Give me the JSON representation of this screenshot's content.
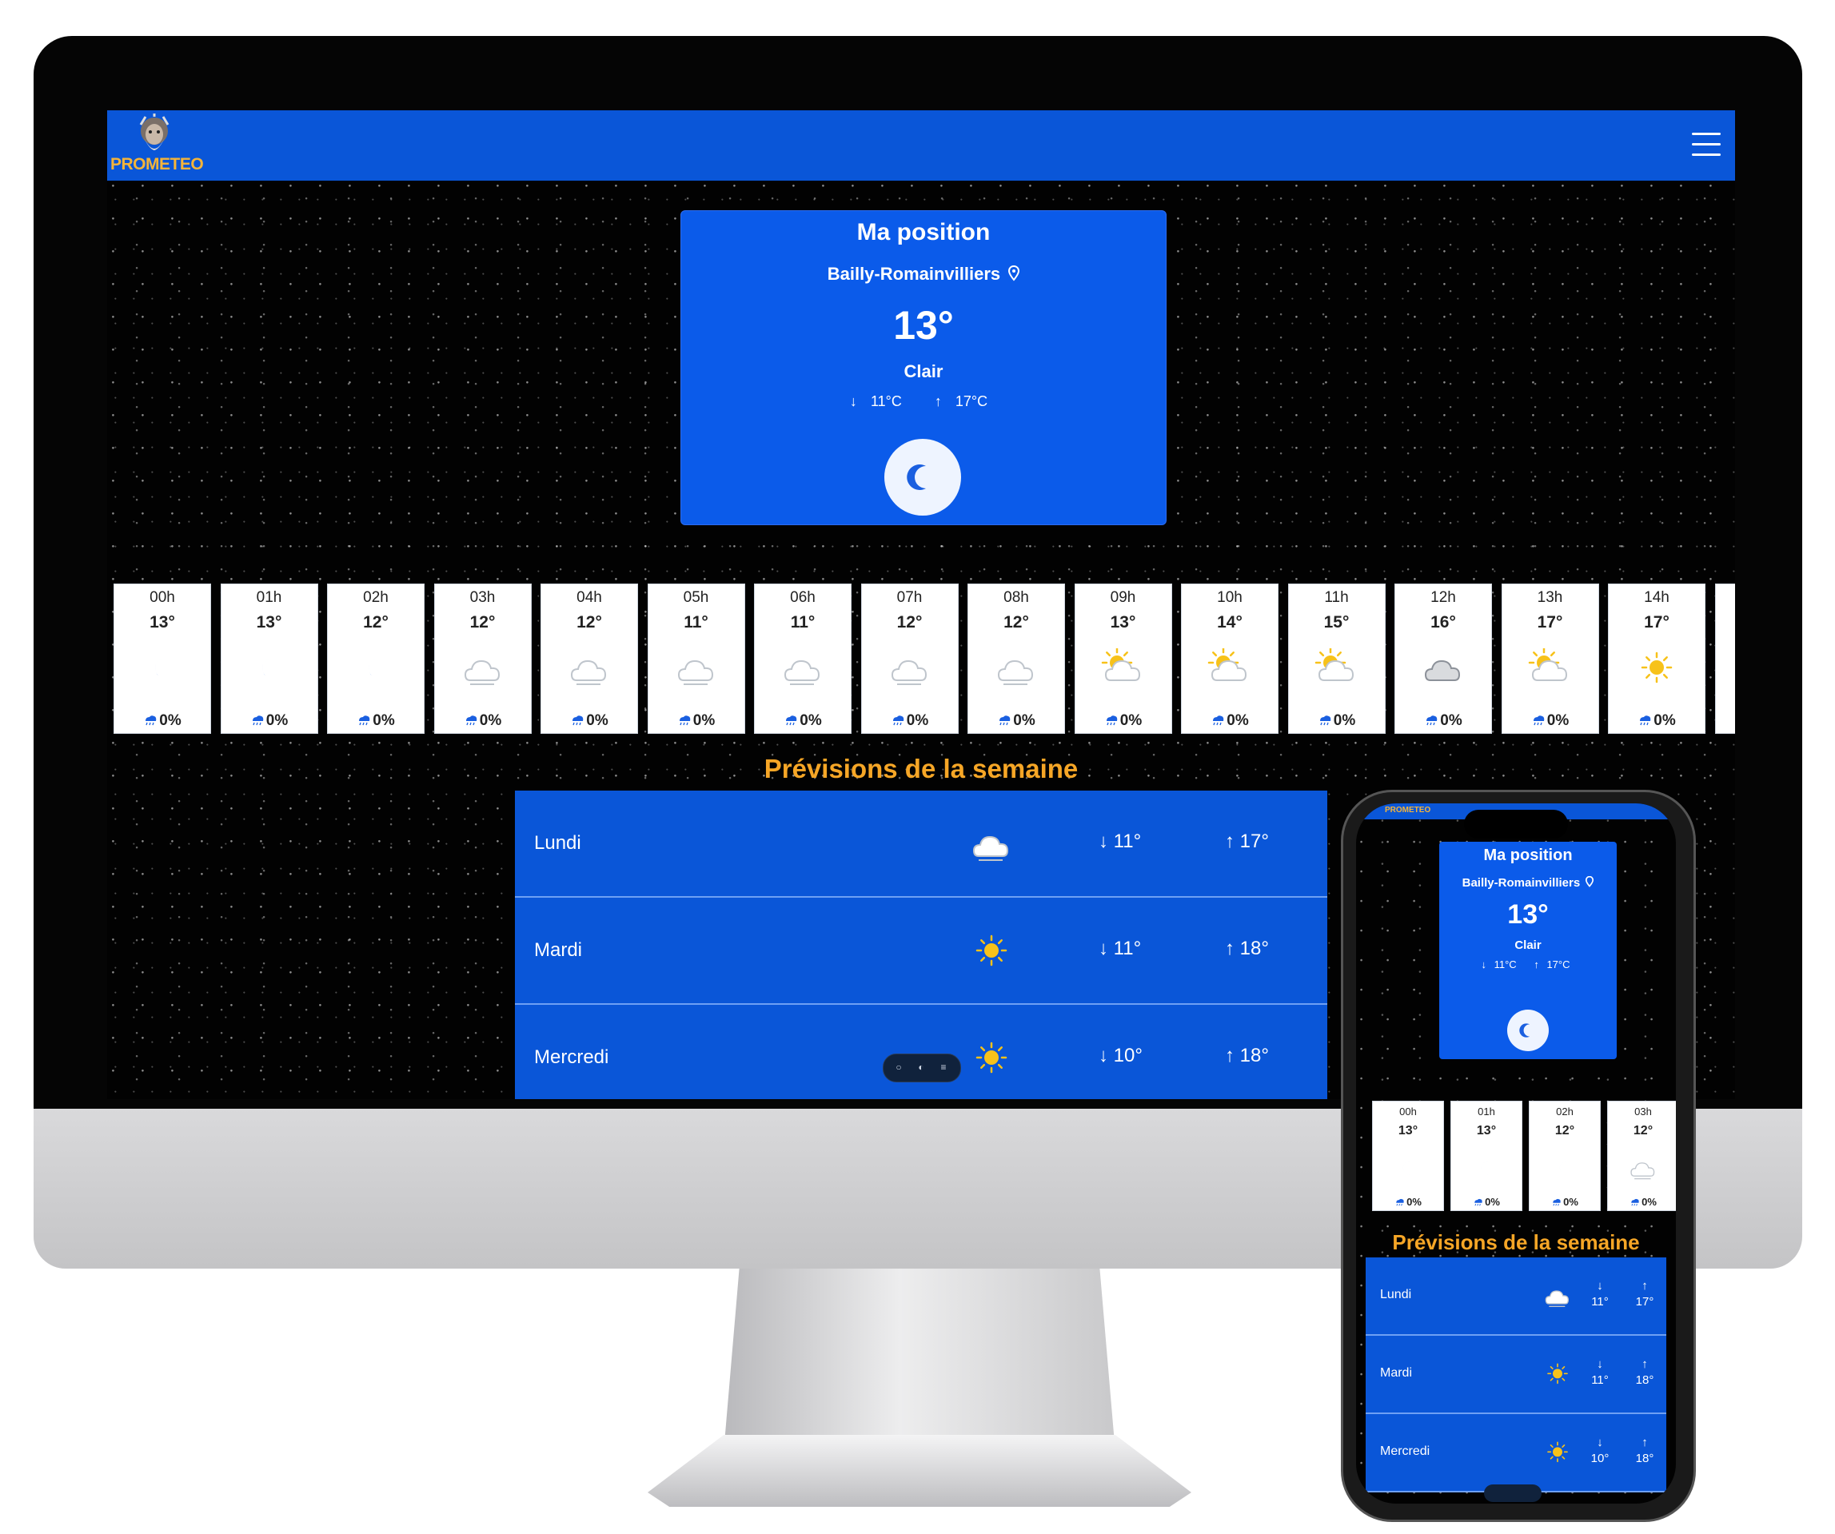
{
  "app": {
    "logo_text": "PROMETEO"
  },
  "current": {
    "title": "Ma position",
    "city": "Bailly-Romainvilliers",
    "temperature": "13°",
    "condition": "Clair",
    "min": "11°C",
    "max": "17°C",
    "icon": "moon-icon"
  },
  "hourly": [
    {
      "time": "00h",
      "temp": "13°",
      "icon": "moon",
      "rain": "0%"
    },
    {
      "time": "01h",
      "temp": "13°",
      "icon": "moon",
      "rain": "0%"
    },
    {
      "time": "02h",
      "temp": "12°",
      "icon": "moon",
      "rain": "0%"
    },
    {
      "time": "03h",
      "temp": "12°",
      "icon": "cloud",
      "rain": "0%"
    },
    {
      "time": "04h",
      "temp": "12°",
      "icon": "cloud",
      "rain": "0%"
    },
    {
      "time": "05h",
      "temp": "11°",
      "icon": "cloud",
      "rain": "0%"
    },
    {
      "time": "06h",
      "temp": "11°",
      "icon": "cloud",
      "rain": "0%"
    },
    {
      "time": "07h",
      "temp": "12°",
      "icon": "cloud",
      "rain": "0%"
    },
    {
      "time": "08h",
      "temp": "12°",
      "icon": "cloud",
      "rain": "0%"
    },
    {
      "time": "09h",
      "temp": "13°",
      "icon": "partly-sunny",
      "rain": "0%"
    },
    {
      "time": "10h",
      "temp": "14°",
      "icon": "partly-sunny",
      "rain": "0%"
    },
    {
      "time": "11h",
      "temp": "15°",
      "icon": "partly-sunny",
      "rain": "0%"
    },
    {
      "time": "12h",
      "temp": "16°",
      "icon": "overcast",
      "rain": "0%"
    },
    {
      "time": "13h",
      "temp": "17°",
      "icon": "partly-sunny",
      "rain": "0%"
    },
    {
      "time": "14h",
      "temp": "17°",
      "icon": "sun",
      "rain": "0%"
    }
  ],
  "week": {
    "title": "Prévisions de la semaine",
    "days": [
      {
        "day": "Lundi",
        "icon": "cloud",
        "min": "11°",
        "max": "17°"
      },
      {
        "day": "Mardi",
        "icon": "sun",
        "min": "11°",
        "max": "18°"
      },
      {
        "day": "Mercredi",
        "icon": "sun",
        "min": "10°",
        "max": "18°"
      }
    ]
  },
  "colors": {
    "navbar": "#0a56d8",
    "card": "#0b5bea",
    "accent": "#f6a626",
    "logo": "#f4b43a"
  }
}
